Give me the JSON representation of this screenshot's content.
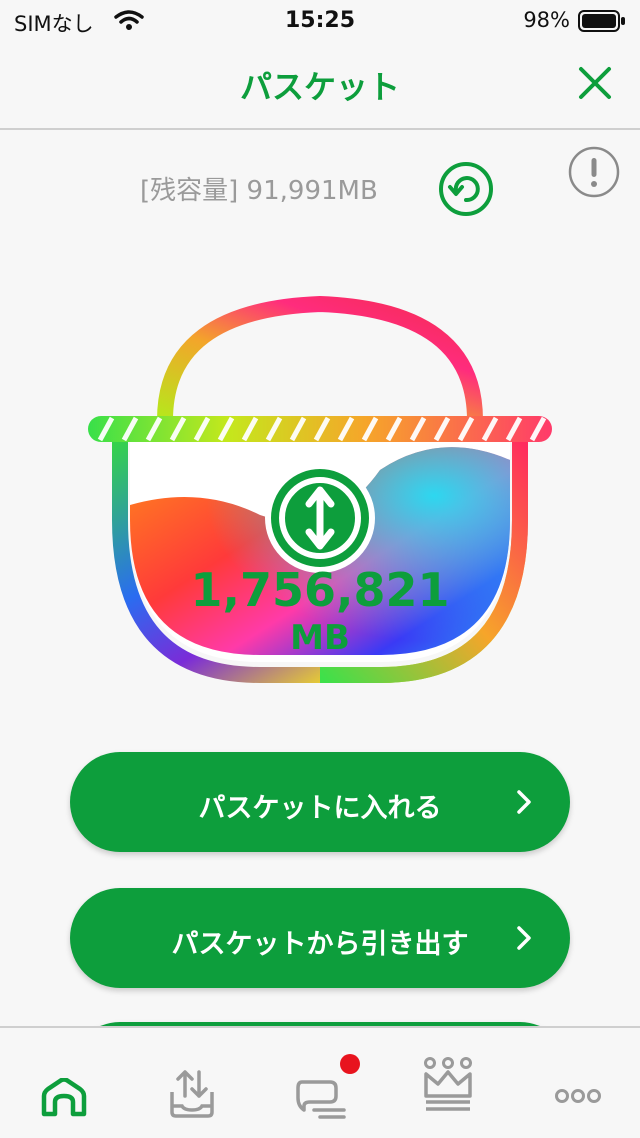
{
  "status_bar": {
    "carrier": "SIMなし",
    "time": "15:25",
    "battery_percent": "98%"
  },
  "nav": {
    "title": "パスケット",
    "close_icon": "close-icon"
  },
  "remaining": {
    "text": "[残容量] 91,991MB"
  },
  "basket": {
    "amount": "1,756,821",
    "unit": "MB"
  },
  "actions": [
    {
      "label": "パスケットに入れる"
    },
    {
      "label": "パスケットから引き出す"
    }
  ],
  "tabs": [
    {
      "icon": "home-icon",
      "active": true
    },
    {
      "icon": "tray-upload-download-icon"
    },
    {
      "icon": "chat-icon",
      "badge": true
    },
    {
      "icon": "crown-icon"
    },
    {
      "icon": "more-icon"
    }
  ],
  "colors": {
    "brand_green": "#0d9e3c",
    "badge_red": "#e8141e",
    "muted_text": "#9a9a9a"
  }
}
